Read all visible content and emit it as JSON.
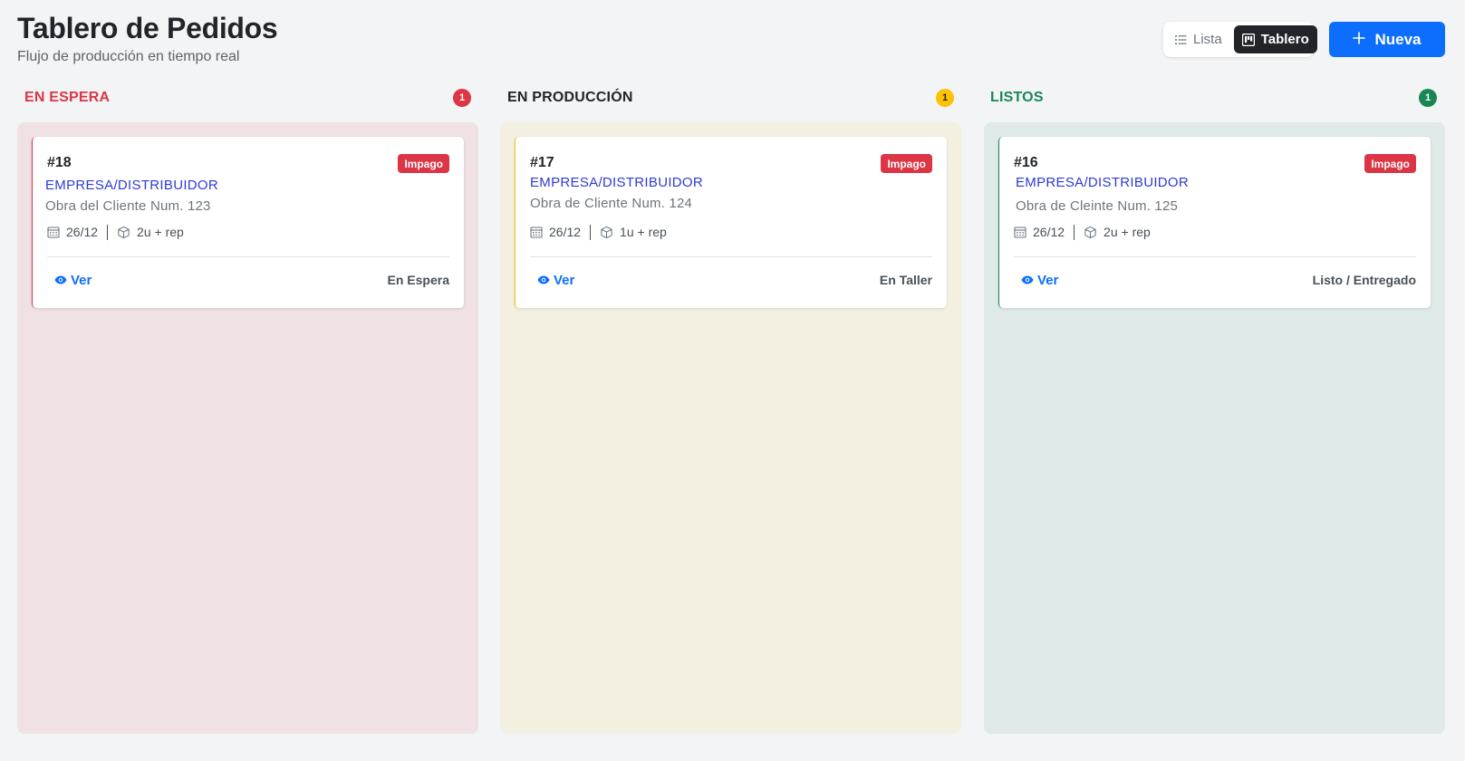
{
  "header": {
    "title": "Tablero de Pedidos",
    "subtitle": "Flujo de producción en tiempo real"
  },
  "view_toggle": {
    "list_label": "Lista",
    "board_label": "Tablero",
    "active": "Tablero"
  },
  "new_button": {
    "label": "Nueva"
  },
  "columns": [
    {
      "title": "EN ESPERA",
      "count": "1",
      "title_color": "#dc3545",
      "badge_color": "#dc3545",
      "badge_text_color": "#ffffff",
      "bg_color": "#f0e1e4",
      "card": {
        "id": "#18",
        "badge": "Impago",
        "client_type": "EMPRESA/DISTRIBUIDOR",
        "work": "Obra del Cliente Num. 123",
        "date": "26/12",
        "units": "2u + rep",
        "view_label": "Ver",
        "stage": "En Espera",
        "border_color": "#dc3545"
      }
    },
    {
      "title": "EN PRODUCCIÓN",
      "count": "1",
      "title_color": "#212529",
      "badge_color": "#ffc107",
      "badge_text_color": "#212529",
      "bg_color": "#f3f0e1",
      "card": {
        "id": "#17",
        "badge": "Impago",
        "client_type": "EMPRESA/DISTRIBUIDOR",
        "work": "Obra de Cliente Num. 124",
        "date": "26/12",
        "units": "1u + rep",
        "view_label": "Ver",
        "stage": "En Taller",
        "border_color": "#ffc107"
      }
    },
    {
      "title": "LISTOS",
      "count": "1",
      "title_color": "#198754",
      "badge_color": "#198754",
      "badge_text_color": "#ffffff",
      "bg_color": "#dfe9e7",
      "card": {
        "id": "#16",
        "badge": "Impago",
        "client_type": "EMPRESA/DISTRIBUIDOR",
        "work": "Obra de Cleinte Num. 125",
        "date": "26/12",
        "units": "2u + rep",
        "view_label": "Ver",
        "stage": "Listo / Entregado",
        "border_color": "#198754"
      }
    }
  ],
  "icons": {
    "list": "list-icon",
    "board": "kanban-icon",
    "new": "plus-icon",
    "date": "calendar-icon",
    "units": "box-icon",
    "view": "eye-icon"
  }
}
